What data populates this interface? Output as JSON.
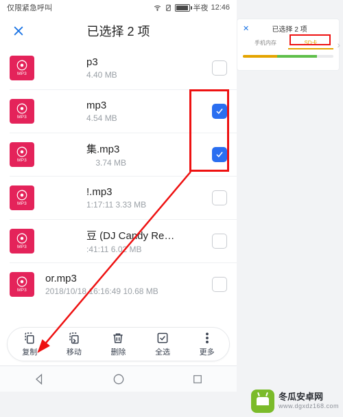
{
  "statusbar": {
    "left": "仅限紧急呼叫",
    "time_prefix": "半夜",
    "time": "12:46"
  },
  "header": {
    "title": "已选择 2 项"
  },
  "mp3_label": "MP3",
  "files": [
    {
      "name": "p3",
      "meta": "4.40 MB",
      "checked": false
    },
    {
      "name": "mp3",
      "meta": "4.54 MB",
      "checked": true
    },
    {
      "name": "集.mp3",
      "meta": "3.74 MB",
      "checked": true
    },
    {
      "name": "!.mp3",
      "meta": "1:17:11 3.33 MB",
      "checked": false
    },
    {
      "name": "豆 (DJ Candy Remix).m…",
      "meta": ":41:11 6.02 MB",
      "checked": false
    },
    {
      "name": "or.mp3",
      "meta": "2018/10/18 16:16:49 10.68 MB",
      "checked": false
    }
  ],
  "actions": {
    "copy": "复制",
    "move": "移动",
    "delete": "删除",
    "select_all": "全选",
    "more": "更多"
  },
  "inset": {
    "title": "已选择 2 项",
    "tab_phone": "手机内存",
    "tab_sd": "SD卡"
  },
  "watermark": {
    "line1": "冬瓜安卓网",
    "line2": "www.dgxdz168.com"
  }
}
